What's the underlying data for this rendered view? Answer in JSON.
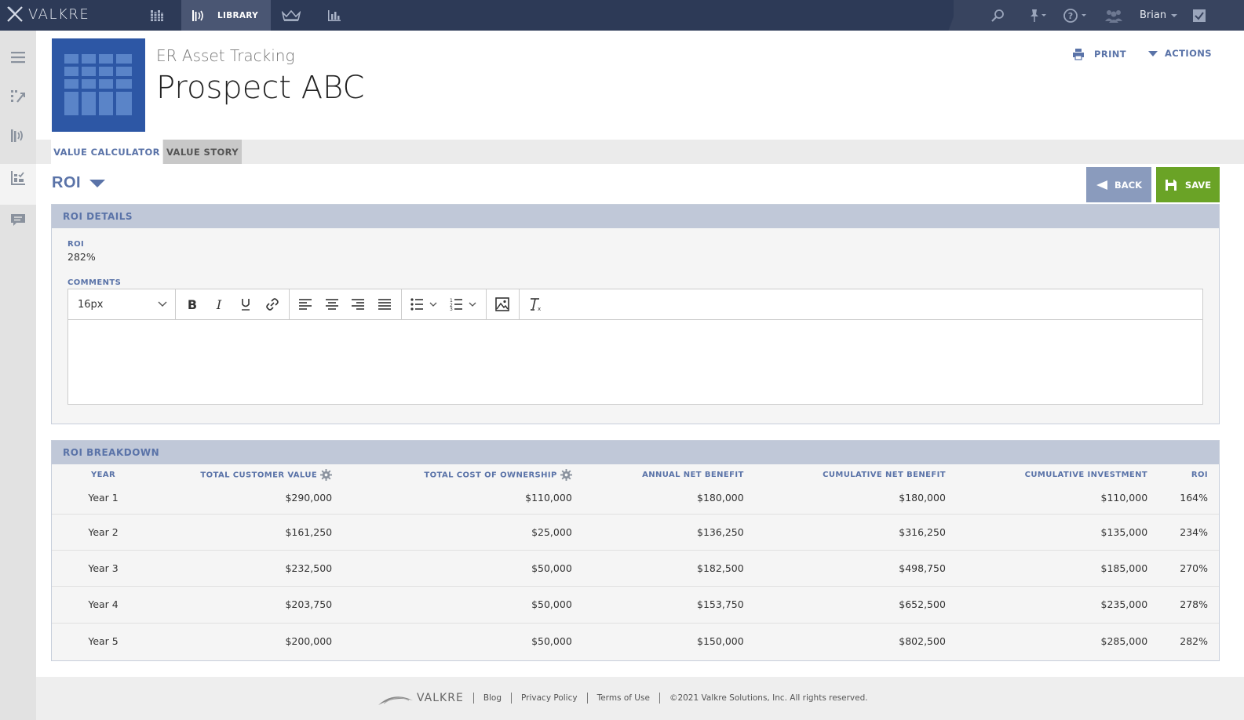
{
  "app": {
    "brand": "VALKRE"
  },
  "topnav": {
    "library_label": "LIBRARY",
    "user_name": "Brian"
  },
  "header": {
    "subtitle": "ER Asset Tracking",
    "title": "Prospect ABC",
    "print_label": "PRINT",
    "actions_label": "ACTIONS"
  },
  "tabs": [
    {
      "label": "VALUE CALCULATOR",
      "active": true
    },
    {
      "label": "VALUE STORY",
      "active": false
    }
  ],
  "main": {
    "section_selector": "ROI",
    "back_label": "BACK",
    "save_label": "SAVE"
  },
  "roi_details": {
    "heading": "ROI DETAILS",
    "roi_label": "ROI",
    "roi_value": "282%",
    "comments_label": "COMMENTS",
    "font_size": "16px"
  },
  "roi_breakdown": {
    "heading": "ROI BREAKDOWN",
    "columns": [
      "YEAR",
      "TOTAL CUSTOMER VALUE",
      "TOTAL COST OF OWNERSHIP",
      "ANNUAL NET BENEFIT",
      "CUMULATIVE NET BENEFIT",
      "CUMULATIVE INVESTMENT",
      "ROI"
    ],
    "rows": [
      [
        "Year 1",
        "$290,000",
        "$110,000",
        "$180,000",
        "$180,000",
        "$110,000",
        "164%"
      ],
      [
        "Year 2",
        "$161,250",
        "$25,000",
        "$136,250",
        "$316,250",
        "$135,000",
        "234%"
      ],
      [
        "Year 3",
        "$232,500",
        "$50,000",
        "$182,500",
        "$498,750",
        "$185,000",
        "270%"
      ],
      [
        "Year 4",
        "$203,750",
        "$50,000",
        "$153,750",
        "$652,500",
        "$235,000",
        "278%"
      ],
      [
        "Year 5",
        "$200,000",
        "$50,000",
        "$150,000",
        "$802,500",
        "$285,000",
        "282%"
      ]
    ]
  },
  "footer": {
    "brand": "VALKRE",
    "links": [
      "Blog",
      "Privacy Policy",
      "Terms of Use"
    ],
    "copyright": "©2021 Valkre Solutions, Inc. All rights reserved."
  },
  "colors": {
    "topbar": "#2d3a57",
    "accent": "#5a73a8",
    "save": "#6aa326",
    "back": "#8a9bbd",
    "panel_head": "#c0c8d8"
  }
}
